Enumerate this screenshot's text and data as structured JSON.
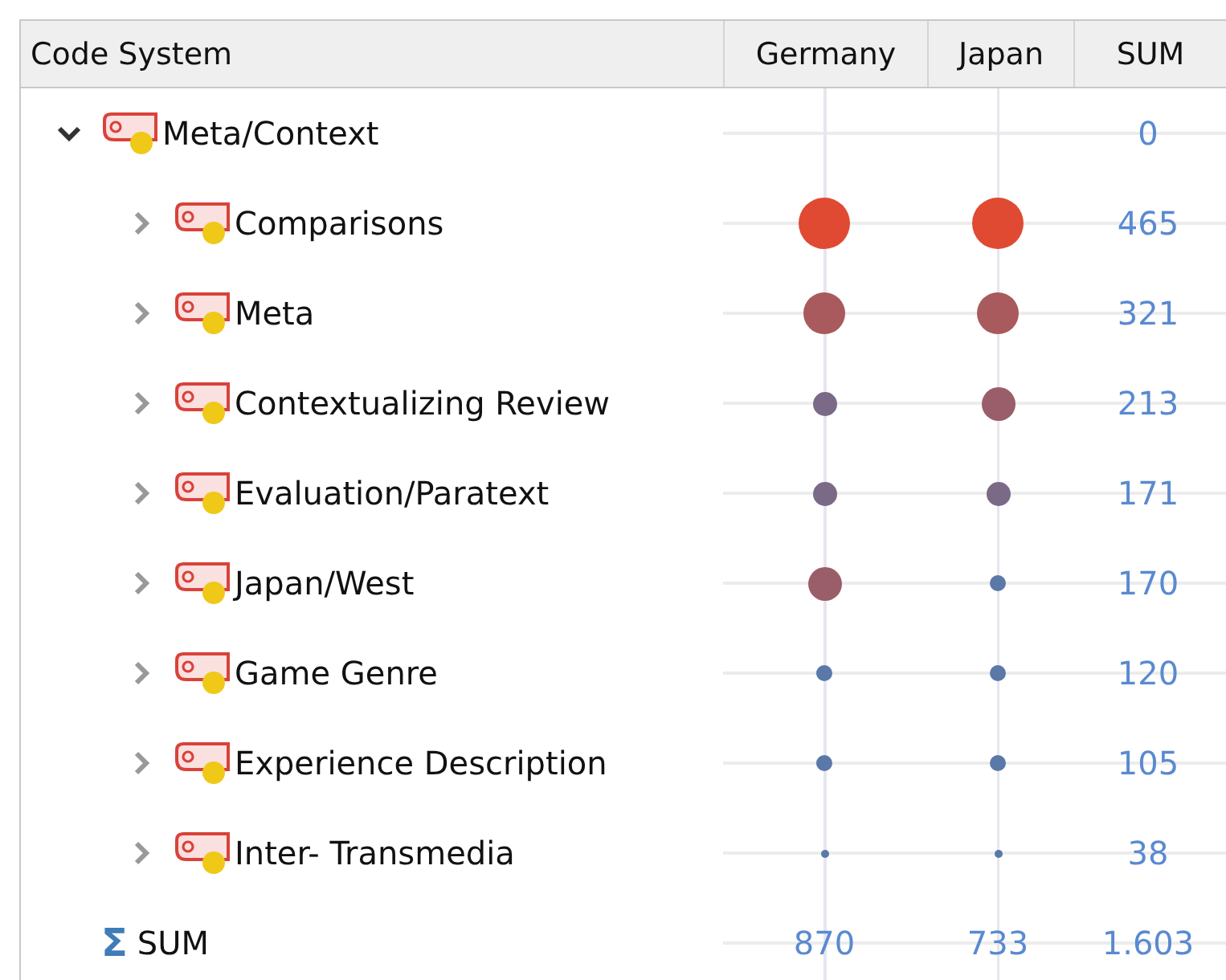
{
  "columns": [
    {
      "label": "Code System"
    },
    {
      "label": "Germany"
    },
    {
      "label": "Japan"
    },
    {
      "label": "SUM"
    }
  ],
  "codes": [
    {
      "name": "Meta/Context",
      "expanded": true,
      "sum": "0",
      "children": [
        {
          "name": "Comparisons",
          "expanded": false,
          "cells": [
            {
              "kind": "huge"
            },
            {
              "kind": "huge"
            }
          ],
          "sum": "465"
        },
        {
          "name": "Meta",
          "expanded": false,
          "cells": [
            {
              "kind": "large"
            },
            {
              "kind": "large"
            }
          ],
          "sum": "321"
        },
        {
          "name": "Contextualizing Review",
          "expanded": false,
          "cells": [
            {
              "kind": "small"
            },
            {
              "kind": "medium"
            }
          ],
          "sum": "213"
        },
        {
          "name": "Evaluation/Paratext",
          "expanded": false,
          "cells": [
            {
              "kind": "small"
            },
            {
              "kind": "small"
            }
          ],
          "sum": "171"
        },
        {
          "name": "Japan/West",
          "expanded": false,
          "cells": [
            {
              "kind": "medium"
            },
            {
              "kind": "tiny"
            }
          ],
          "sum": "170"
        },
        {
          "name": "Game Genre",
          "expanded": false,
          "cells": [
            {
              "kind": "tiny"
            },
            {
              "kind": "tiny"
            }
          ],
          "sum": "120"
        },
        {
          "name": "Experience Description",
          "expanded": false,
          "cells": [
            {
              "kind": "tiny"
            },
            {
              "kind": "tiny"
            }
          ],
          "sum": "105"
        },
        {
          "name": "Inter- Transmedia",
          "expanded": false,
          "cells": [
            {
              "kind": "dot"
            },
            {
              "kind": "dot"
            }
          ],
          "sum": "38"
        }
      ]
    }
  ],
  "sum_row": {
    "symbol": "Σ",
    "label": "SUM",
    "values": [
      "870",
      "733",
      "1.603"
    ]
  }
}
